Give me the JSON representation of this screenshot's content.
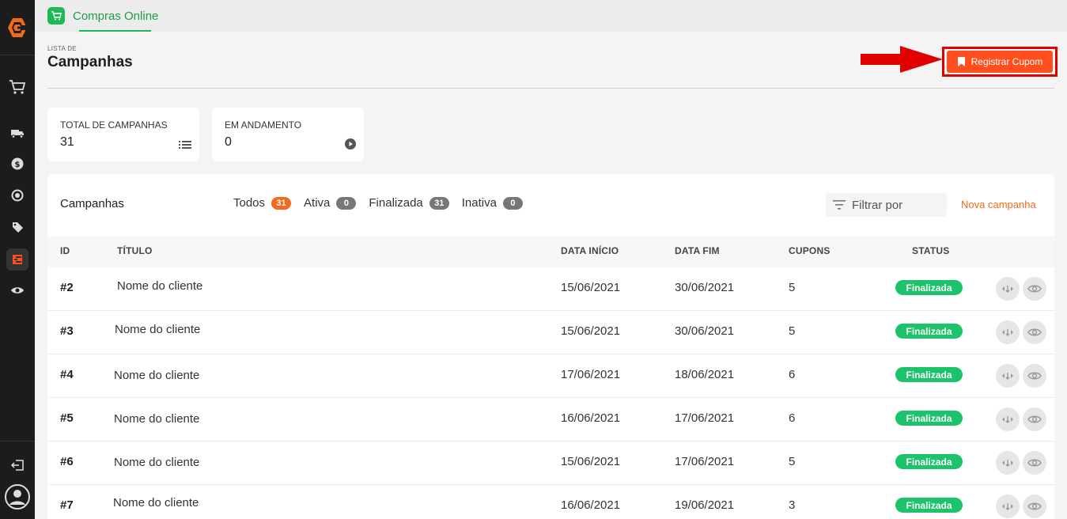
{
  "app": {
    "tab_label": "Compras Online"
  },
  "header": {
    "eyebrow": "LISTA DE",
    "title": "Campanhas",
    "register_button": "Registrar Cupom"
  },
  "stats": [
    {
      "label": "TOTAL DE CAMPANHAS",
      "value": "31",
      "icon": "list-icon"
    },
    {
      "label": "EM ANDAMENTO",
      "value": "0",
      "icon": "play-circle-icon"
    }
  ],
  "panel": {
    "title": "Campanhas",
    "filters": [
      {
        "label": "Todos",
        "count": "31"
      },
      {
        "label": "Ativa",
        "count": "0"
      },
      {
        "label": "Finalizada",
        "count": "31"
      },
      {
        "label": "Inativa",
        "count": "0"
      }
    ],
    "filter_label": "Filtrar por",
    "new_campaign": "Nova campanha"
  },
  "table": {
    "columns": [
      "ID",
      "TÍTULO",
      "DATA INÍCIO",
      "DATA FIM",
      "CUPONS",
      "STATUS"
    ],
    "rows": [
      {
        "id": "#2",
        "title": "Nome do cliente",
        "start": "15/06/2021",
        "end": "30/06/2021",
        "coupons": "5",
        "status": "Finalizada"
      },
      {
        "id": "#3",
        "title": "Nome do cliente",
        "start": "15/06/2021",
        "end": "30/06/2021",
        "coupons": "5",
        "status": "Finalizada"
      },
      {
        "id": "#4",
        "title": "Nome do cliente",
        "start": "17/06/2021",
        "end": "18/06/2021",
        "coupons": "6",
        "status": "Finalizada"
      },
      {
        "id": "#5",
        "title": "Nome do cliente",
        "start": "16/06/2021",
        "end": "17/06/2021",
        "coupons": "6",
        "status": "Finalizada"
      },
      {
        "id": "#6",
        "title": "Nome do cliente",
        "start": "15/06/2021",
        "end": "17/06/2021",
        "coupons": "5",
        "status": "Finalizada"
      },
      {
        "id": "#7",
        "title": "Nome do cliente",
        "start": "16/06/2021",
        "end": "19/06/2021",
        "coupons": "3",
        "status": "Finalizada"
      }
    ]
  },
  "sidebar": {
    "icons": [
      "cart-icon",
      "truck-icon",
      "dollar-icon",
      "exchange-icon",
      "tag-icon",
      "campaign-icon",
      "eye-icon",
      "logout-icon",
      "user-avatar-icon"
    ]
  },
  "colors": {
    "brand_orange": "#ff4f1f",
    "accent_green": "#1db954",
    "status_green": "#1dc36b",
    "highlight_red": "#e00000"
  }
}
